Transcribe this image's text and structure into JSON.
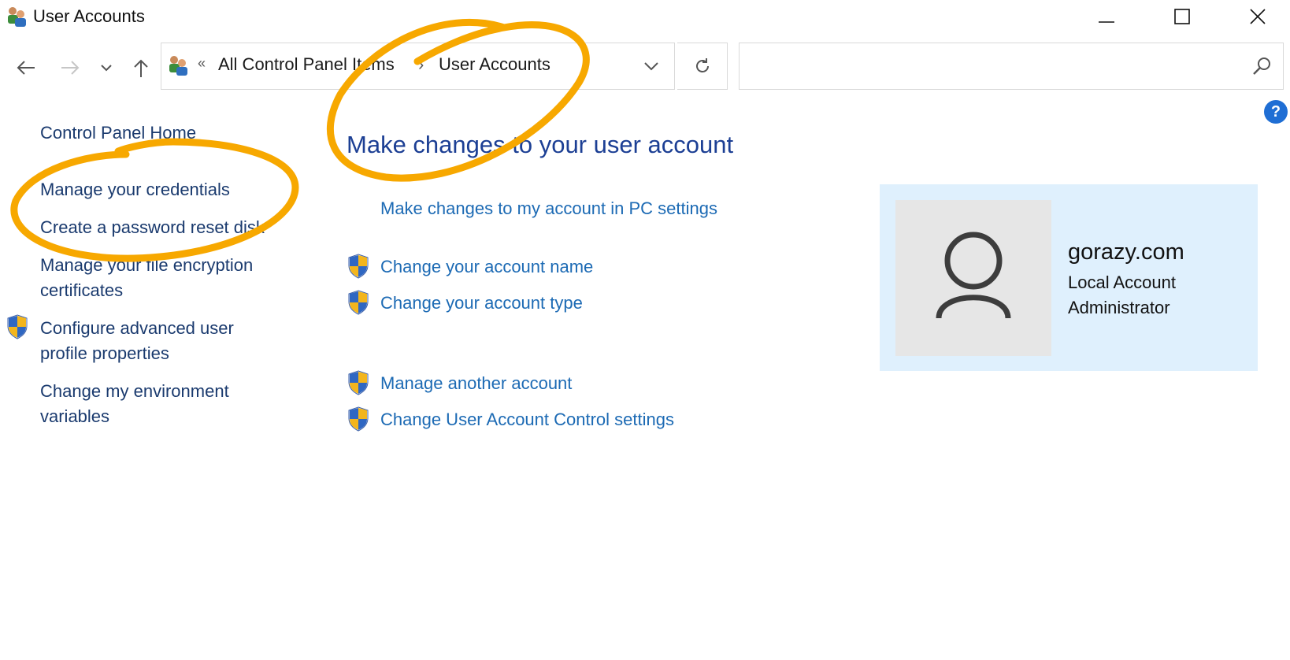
{
  "window": {
    "title": "User Accounts",
    "app_icon": "users-icon"
  },
  "title_bar_controls": [
    "minimize-icon",
    "maximize-icon",
    "close-icon"
  ],
  "navigation": {
    "back_icon": "arrow-left-icon",
    "forward_icon": "arrow-right-icon",
    "recent_icon": "chevron-down-icon",
    "up_icon": "arrow-up-icon"
  },
  "address_bar": {
    "overflow": "«",
    "breadcrumbs": [
      "All Control Panel Items",
      "User Accounts"
    ],
    "separator": "›",
    "dropdown_icon": "chevron-down-icon",
    "refresh_icon": "refresh-icon"
  },
  "search": {
    "value": "",
    "placeholder": "",
    "icon": "search-icon"
  },
  "help": {
    "label": "?"
  },
  "left_pane": {
    "items": [
      {
        "label": "Control Panel Home",
        "shield": false
      },
      {
        "label": "Manage your credentials",
        "shield": false
      },
      {
        "label": "Create a password reset disk",
        "shield": false
      },
      {
        "label": "Manage your file encryption certificates",
        "shield": false
      },
      {
        "label": "Configure advanced user profile properties",
        "shield": true
      },
      {
        "label": "Change my environment variables",
        "shield": false
      }
    ]
  },
  "main": {
    "title": "Make changes to your user account",
    "links": [
      {
        "label": "Make changes to my account in PC settings",
        "shield": false
      },
      {
        "label": "Change your account name",
        "shield": true
      },
      {
        "label": "Change your account type",
        "shield": true
      },
      {
        "label": "Manage another account",
        "shield": true
      },
      {
        "label": "Change User Account Control settings",
        "shield": true
      }
    ]
  },
  "account": {
    "name": "gorazy.com",
    "type": "Local Account",
    "role": "Administrator",
    "avatar_icon": "user-avatar-icon"
  },
  "colors": {
    "link": "#1c6ab4",
    "title": "#1c3f94",
    "card_bg": "#dff0fd",
    "annotation": "#f7a800",
    "help": "#1f6ed4"
  }
}
